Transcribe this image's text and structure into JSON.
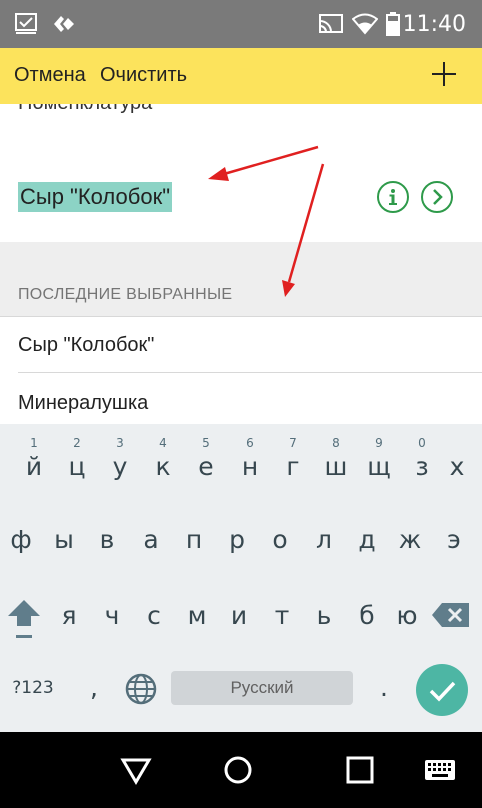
{
  "status_bar": {
    "time": "11:40",
    "icons": [
      "checkbox-notification-icon",
      "diamond-notification-icon",
      "cast-icon",
      "wifi-icon",
      "battery-icon"
    ]
  },
  "toolbar": {
    "cancel_label": "Отмена",
    "clear_label": "Очистить",
    "add_icon": "plus-icon"
  },
  "field": {
    "label": "Номенклатура",
    "value": "Сыр \"Колобок\"",
    "info_icon": "info-icon",
    "go_icon": "chevron-right-icon"
  },
  "recent": {
    "title": "ПОСЛЕДНИЕ ВЫБРАННЫЕ",
    "items": [
      "Сыр \"Колобок\"",
      "Минералушка"
    ]
  },
  "keyboard": {
    "row1": [
      {
        "num": "1",
        "char": "й"
      },
      {
        "num": "2",
        "char": "ц"
      },
      {
        "num": "3",
        "char": "у"
      },
      {
        "num": "4",
        "char": "к"
      },
      {
        "num": "5",
        "char": "е"
      },
      {
        "num": "6",
        "char": "н"
      },
      {
        "num": "7",
        "char": "г"
      },
      {
        "num": "8",
        "char": "ш"
      },
      {
        "num": "9",
        "char": "щ"
      },
      {
        "num": "0",
        "char": "з"
      },
      {
        "num": "",
        "char": "х"
      }
    ],
    "row2": [
      "ф",
      "ы",
      "в",
      "а",
      "п",
      "р",
      "о",
      "л",
      "д",
      "ж",
      "э"
    ],
    "row3": [
      "я",
      "ч",
      "с",
      "м",
      "и",
      "т",
      "ь",
      "б",
      "ю"
    ],
    "symbols_label": "?123",
    "comma": ",",
    "space_label": "Русский",
    "period": "."
  },
  "colors": {
    "toolbar": "#fce35c",
    "highlight": "#8cd3c5",
    "accent_green": "#2e9a4a",
    "annotation_arrow": "#e02020",
    "enter_key": "#4db6a4"
  }
}
